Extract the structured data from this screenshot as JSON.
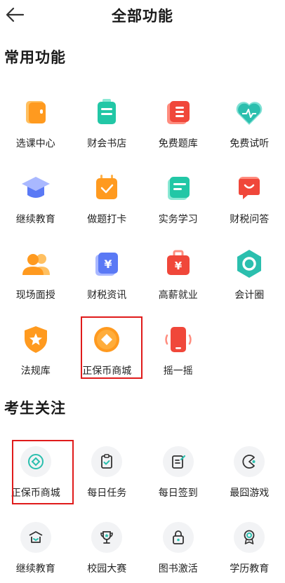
{
  "header": {
    "title": "全部功能"
  },
  "sections": {
    "common": {
      "title": "常用功能",
      "items": [
        {
          "label": "选课中心"
        },
        {
          "label": "财会书店"
        },
        {
          "label": "免费题库"
        },
        {
          "label": "免费试听"
        },
        {
          "label": "继续教育"
        },
        {
          "label": "做题打卡"
        },
        {
          "label": "实务学习"
        },
        {
          "label": "财税问答"
        },
        {
          "label": "现场面授"
        },
        {
          "label": "财税资讯"
        },
        {
          "label": "高薪就业"
        },
        {
          "label": "会计圈"
        },
        {
          "label": "法规库"
        },
        {
          "label": "正保币商城"
        },
        {
          "label": "摇一摇"
        }
      ]
    },
    "exam": {
      "title": "考生关注",
      "items": [
        {
          "label": "正保币商城"
        },
        {
          "label": "每日任务"
        },
        {
          "label": "每日签到"
        },
        {
          "label": "最囧游戏"
        },
        {
          "label": "继续教育"
        },
        {
          "label": "校园大赛"
        },
        {
          "label": "图书激活"
        },
        {
          "label": "学历教育"
        }
      ]
    }
  },
  "colors": {
    "highlight": "#e01b1b",
    "orange": "#ff9a1f",
    "green": "#22c7a6",
    "red": "#f0473a",
    "blue": "#5a79f5",
    "teal": "#2bbfae"
  }
}
